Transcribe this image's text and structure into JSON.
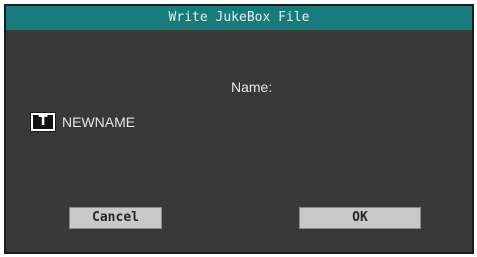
{
  "dialog": {
    "title": "Write JukeBox File",
    "name_label": "Name:",
    "text_edit_icon": "T",
    "name_value": "NEWNAME",
    "cancel_label": "Cancel",
    "ok_label": "OK"
  },
  "colors": {
    "title_bar": "#177b7b",
    "background": "#393939",
    "button": "#c9c9c9"
  }
}
